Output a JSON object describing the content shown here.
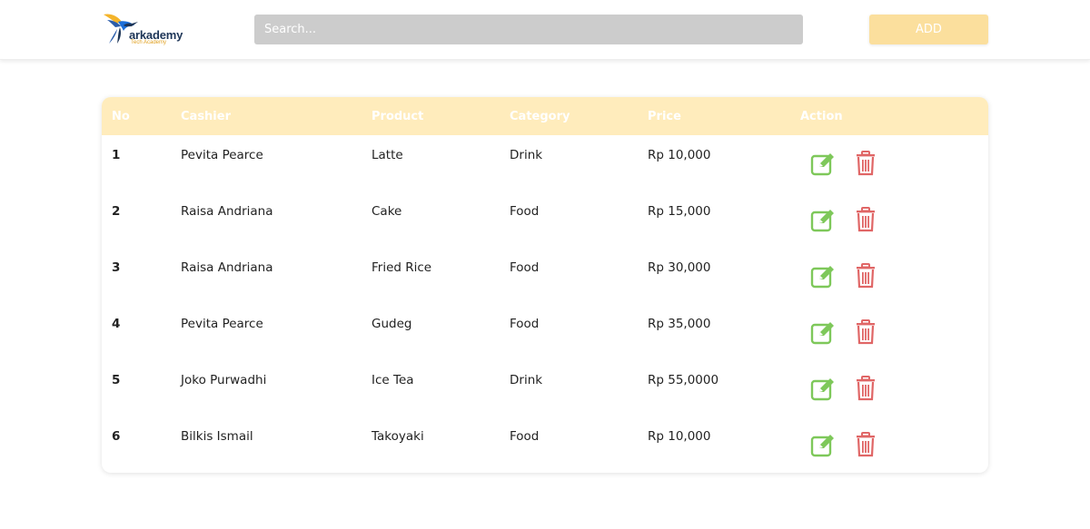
{
  "header": {
    "logo_name": "arkademy",
    "logo_sub": "Tech Academy",
    "search_placeholder": "Search...",
    "add_label": "ADD"
  },
  "colors": {
    "header_bg": "#ffecbc",
    "add_button": "#fbdf9d",
    "search_bg": "#cccccc",
    "edit_icon": "#7ec85a",
    "delete_icon": "#e06666"
  },
  "table": {
    "columns": [
      "No",
      "Cashier",
      "Product",
      "Category",
      "Price",
      "Action"
    ],
    "rows": [
      {
        "no": "1",
        "cashier": "Pevita Pearce",
        "product": "Latte",
        "category": "Drink",
        "price": "Rp 10,000"
      },
      {
        "no": "2",
        "cashier": "Raisa Andriana",
        "product": "Cake",
        "category": "Food",
        "price": "Rp 15,000"
      },
      {
        "no": "3",
        "cashier": "Raisa Andriana",
        "product": "Fried Rice",
        "category": "Food",
        "price": "Rp 30,000"
      },
      {
        "no": "4",
        "cashier": "Pevita Pearce",
        "product": "Gudeg",
        "category": "Food",
        "price": "Rp 35,000"
      },
      {
        "no": "5",
        "cashier": "Joko Purwadhi",
        "product": "Ice Tea",
        "category": "Drink",
        "price": "Rp 55,0000"
      },
      {
        "no": "6",
        "cashier": "Bilkis Ismail",
        "product": "Takoyaki",
        "category": "Food",
        "price": "Rp 10,000"
      }
    ],
    "row_icons": [
      "edit-icon",
      "trash-icon"
    ]
  }
}
